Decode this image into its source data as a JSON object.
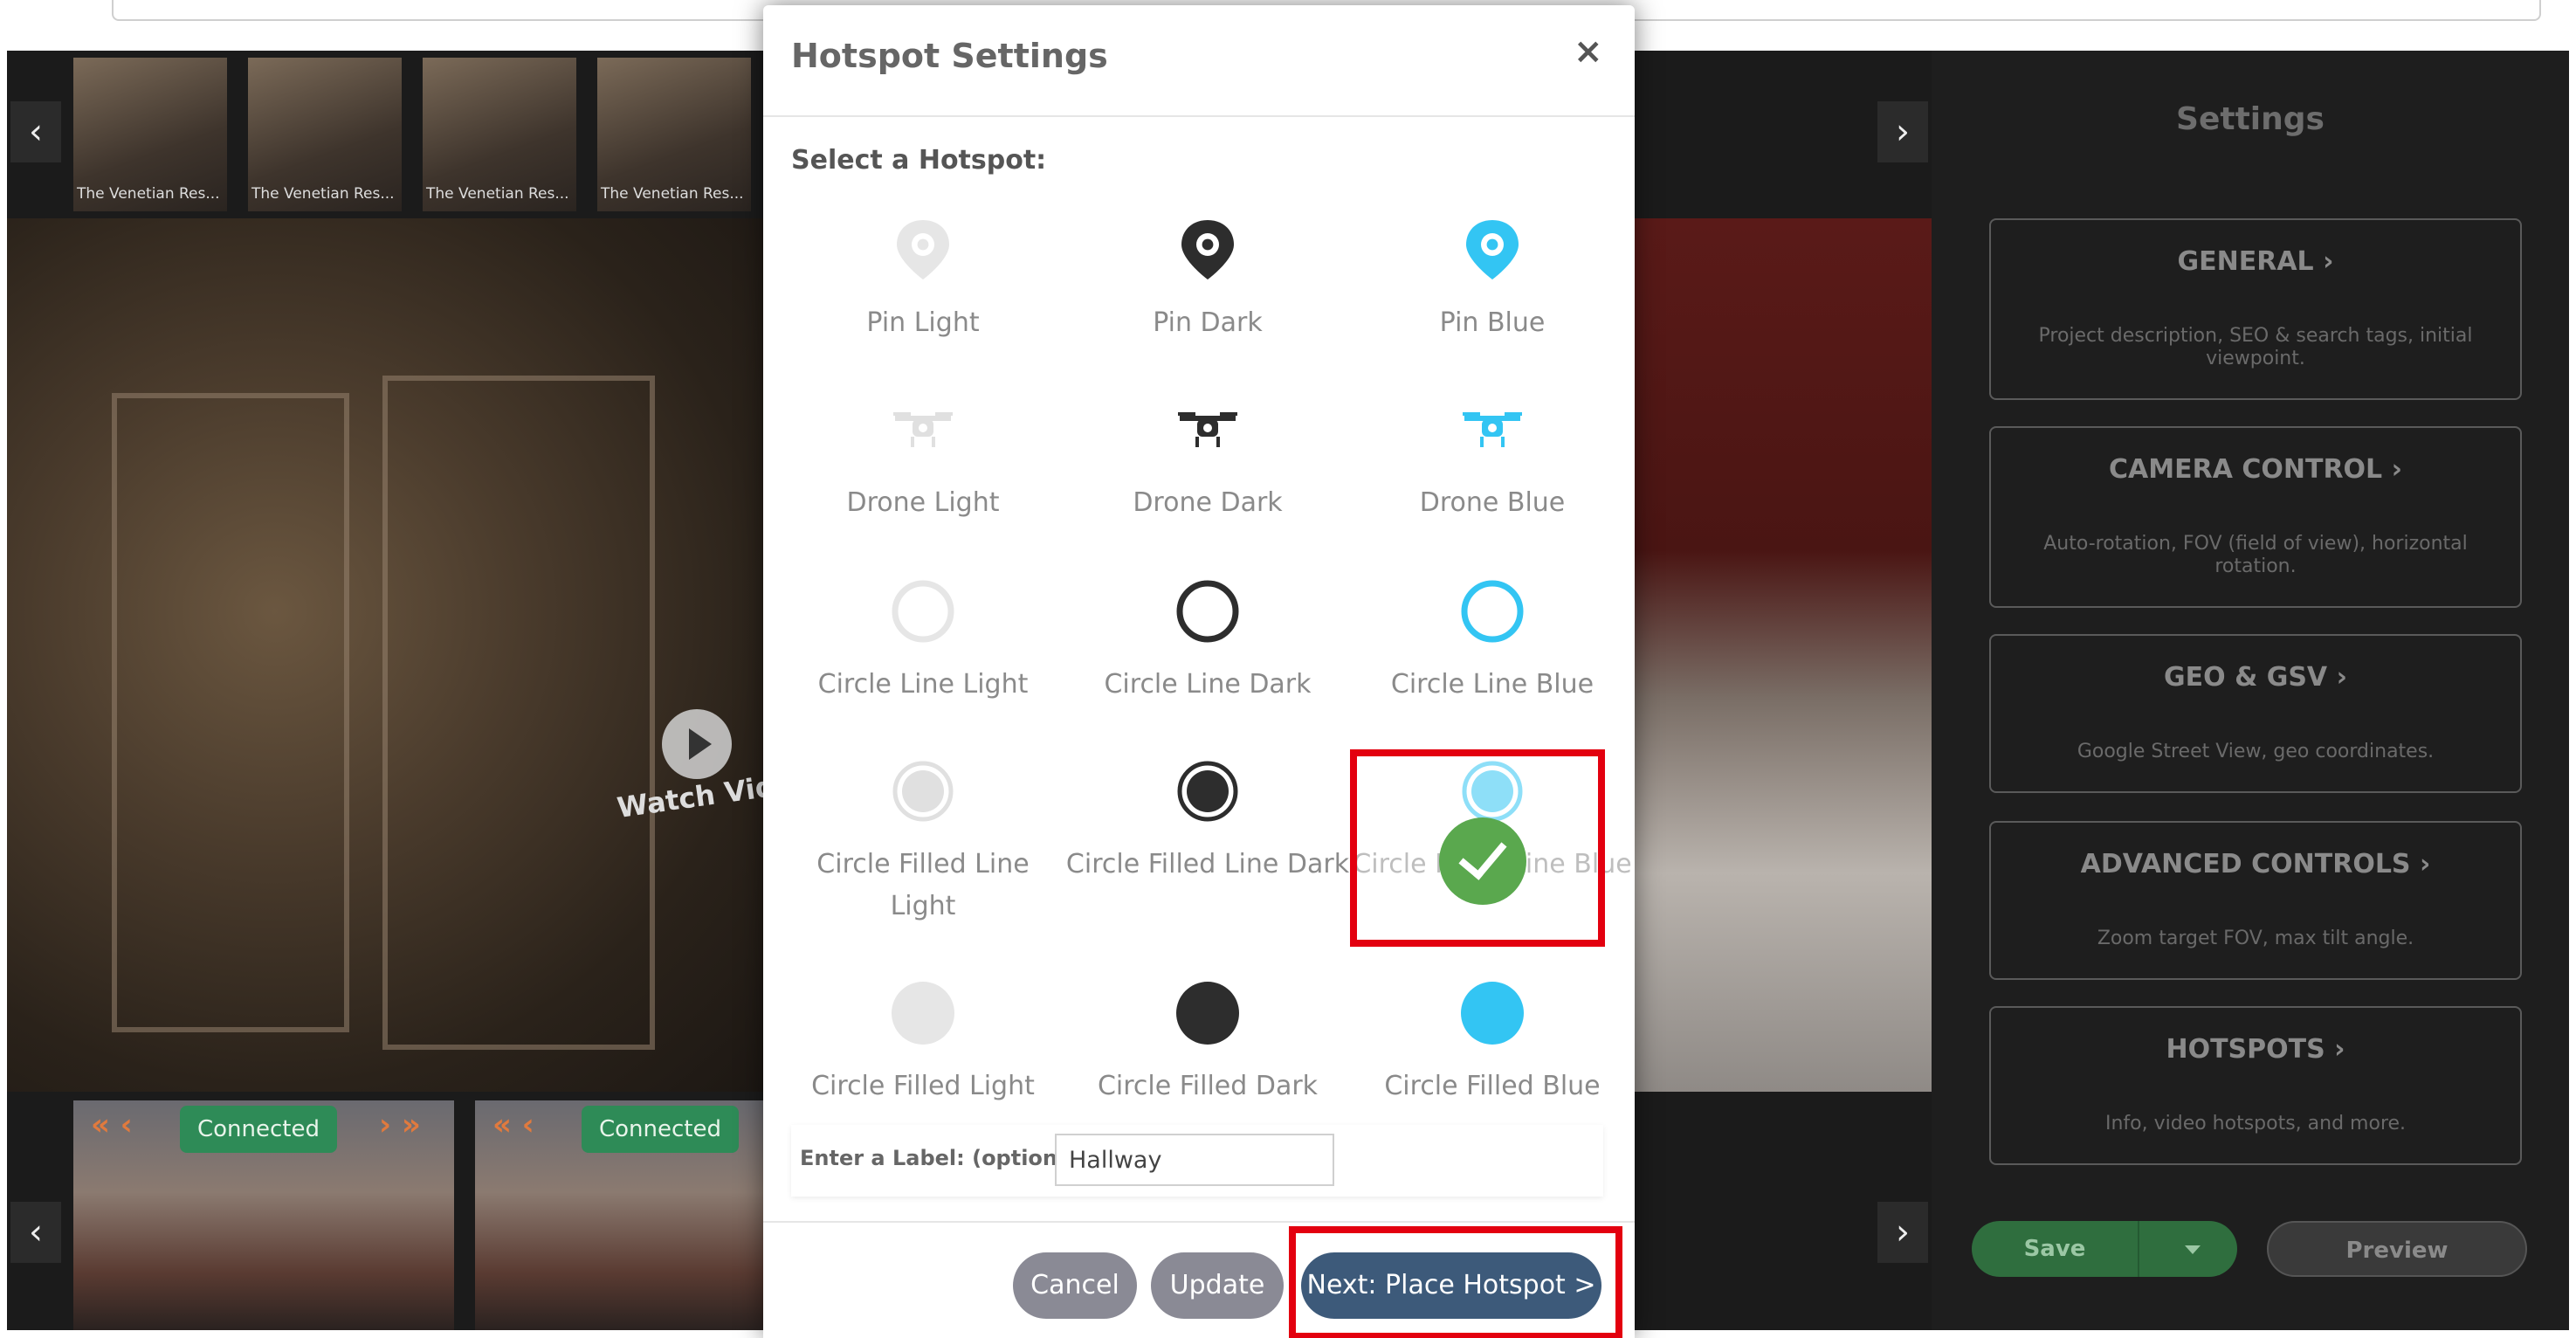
{
  "background": {
    "thumbnails": [
      {
        "caption": "The Venetian Res..."
      },
      {
        "caption": "The Venetian Res..."
      },
      {
        "caption": "The Venetian Res..."
      },
      {
        "caption": "The Venetian Res..."
      }
    ],
    "watch_video_label": "Watch Vide",
    "bottom_thumbs": [
      {
        "status": "Connected"
      },
      {
        "status": "Connected"
      }
    ],
    "arrows": {
      "left": "‹",
      "right": "›"
    }
  },
  "settings": {
    "title": "Settings",
    "cards": [
      {
        "title": "GENERAL ›",
        "desc": "Project description, SEO & search tags, initial viewpoint."
      },
      {
        "title": "CAMERA CONTROL ›",
        "desc": "Auto-rotation, FOV (field of view), horizontal rotation."
      },
      {
        "title": "GEO & GSV ›",
        "desc": "Google Street View, geo coordinates."
      },
      {
        "title": "ADVANCED CONTROLS ›",
        "desc": "Zoom target FOV, max tilt angle."
      },
      {
        "title": "HOTSPOTS ›",
        "desc": "Info, video hotspots, and more."
      }
    ],
    "save_label": "Save",
    "preview_label": "Preview"
  },
  "modal": {
    "title": "Hotspot Settings",
    "close": "×",
    "select_label": "Select a Hotspot:",
    "options": [
      {
        "label": "Pin Light",
        "icon": "pin-icon",
        "color": "#e6e6e6"
      },
      {
        "label": "Pin Dark",
        "icon": "pin-icon",
        "color": "#2d2d2d"
      },
      {
        "label": "Pin Blue",
        "icon": "pin-icon",
        "color": "#33c5f3"
      },
      {
        "label": "Drone Light",
        "icon": "drone-icon",
        "color": "#e0e0e0"
      },
      {
        "label": "Drone Dark",
        "icon": "drone-icon",
        "color": "#2d2d2d"
      },
      {
        "label": "Drone Blue",
        "icon": "drone-icon",
        "color": "#33c5f3"
      },
      {
        "label": "Circle Line Light",
        "icon": "circle-line-icon",
        "color": "#e6e6e6"
      },
      {
        "label": "Circle Line Dark",
        "icon": "circle-line-icon",
        "color": "#2d2d2d"
      },
      {
        "label": "Circle Line Blue",
        "icon": "circle-line-icon",
        "color": "#33c5f3"
      },
      {
        "label": "Circle Filled Line Light",
        "icon": "circle-filled-line-icon",
        "color": "#e0e0e0"
      },
      {
        "label": "Circle Filled Line Dark",
        "icon": "circle-filled-line-icon",
        "color": "#2d2d2d"
      },
      {
        "label": "Circle Filled Line Blue",
        "icon": "circle-filled-line-icon",
        "color": "#33c5f3",
        "selected": true
      },
      {
        "label": "Circle Filled Light",
        "icon": "circle-filled-icon",
        "color": "#e6e6e6"
      },
      {
        "label": "Circle Filled Dark",
        "icon": "circle-filled-icon",
        "color": "#2d2d2d"
      },
      {
        "label": "Circle Filled Blue",
        "icon": "circle-filled-icon",
        "color": "#33c5f3"
      }
    ],
    "label_prompt": "Enter a Label: (optional)",
    "label_value": "Hallway",
    "cancel_label": "Cancel",
    "update_label": "Update",
    "next_label": "Next: Place Hotspot >"
  }
}
